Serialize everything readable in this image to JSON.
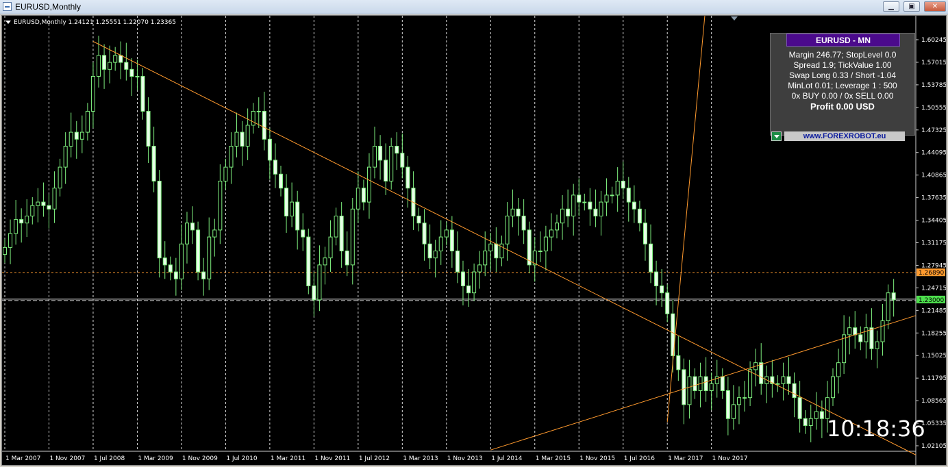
{
  "window": {
    "title": "EURUSD,Monthly",
    "minimize": "▁",
    "restore": "▣",
    "close": "✕"
  },
  "chart_header": "EURUSD,Monthly  1.24121 1.25551 1.22070 1.23365",
  "clock": "10:18:36",
  "info_panel": {
    "title": "EURUSD - MN",
    "lines": [
      "Margin 246.77; StopLevel 0.0",
      "Spread 1.9; TickValue 1.00",
      "Swap Long 0.33 / Short -1.04",
      "MinLot 0.01; Leverage 1 : 500",
      "0x BUY 0.00 / 0x SELL 0.00"
    ],
    "profit": "Profit 0.00 USD",
    "link": "www.FOREXROBOT.eu"
  },
  "colors": {
    "background": "#000000",
    "candle_up_fill": "#000000",
    "candle_up_border": "#7ff07f",
    "candle_down_fill": "#e8ffe8",
    "grid": "#ffffff",
    "trendline": "#ff9a2e",
    "current_price_badge": "#4de04d",
    "level_badge": "#ff9a2e",
    "panel_title": "#4b0a8c"
  },
  "chart_data": {
    "type": "candlestick",
    "symbol": "EURUSD",
    "timeframe": "Monthly",
    "ylim": [
      1.01,
      1.62
    ],
    "y_ticks": [
      "1.60245",
      "1.57015",
      "1.53785",
      "1.50555",
      "1.47325",
      "1.44095",
      "1.40865",
      "1.37635",
      "1.34405",
      "1.31175",
      "1.27945",
      "1.24715",
      "1.21485",
      "1.18255",
      "1.15025",
      "1.11795",
      "1.08565",
      "1.05335",
      "1.02105"
    ],
    "x_ticks": [
      "1 Mar 2007",
      "1 Nov 2007",
      "1 Jul 2008",
      "1 Mar 2009",
      "1 Nov 2009",
      "1 Jul 2010",
      "1 Mar 2011",
      "1 Nov 2011",
      "1 Jul 2012",
      "1 Mar 2013",
      "1 Nov 2013",
      "1 Jul 2014",
      "1 Mar 2015",
      "1 Nov 2015",
      "1 Jul 2016",
      "1 Mar 2017",
      "1 Nov 2017"
    ],
    "closes": [
      1.305,
      1.325,
      1.345,
      1.34,
      1.35,
      1.365,
      1.37,
      1.365,
      1.36,
      1.39,
      1.42,
      1.45,
      1.47,
      1.46,
      1.47,
      1.5,
      1.55,
      1.58,
      1.56,
      1.57,
      1.58,
      1.57,
      1.56,
      1.55,
      1.55,
      1.5,
      1.45,
      1.4,
      1.29,
      1.28,
      1.27,
      1.26,
      1.31,
      1.34,
      1.33,
      1.27,
      1.26,
      1.32,
      1.33,
      1.4,
      1.42,
      1.45,
      1.47,
      1.45,
      1.48,
      1.5,
      1.5,
      1.46,
      1.43,
      1.41,
      1.39,
      1.35,
      1.37,
      1.33,
      1.32,
      1.25,
      1.23,
      1.28,
      1.29,
      1.32,
      1.35,
      1.3,
      1.28,
      1.36,
      1.39,
      1.37,
      1.42,
      1.45,
      1.43,
      1.4,
      1.45,
      1.44,
      1.42,
      1.39,
      1.35,
      1.34,
      1.31,
      1.29,
      1.3,
      1.32,
      1.33,
      1.3,
      1.27,
      1.25,
      1.24,
      1.27,
      1.28,
      1.3,
      1.31,
      1.29,
      1.31,
      1.35,
      1.36,
      1.35,
      1.33,
      1.28,
      1.3,
      1.3,
      1.32,
      1.33,
      1.34,
      1.36,
      1.35,
      1.38,
      1.37,
      1.37,
      1.36,
      1.35,
      1.37,
      1.38,
      1.38,
      1.4,
      1.39,
      1.37,
      1.36,
      1.34,
      1.31,
      1.27,
      1.25,
      1.24,
      1.21,
      1.15,
      1.13,
      1.08,
      1.12,
      1.1,
      1.12,
      1.1,
      1.11,
      1.12,
      1.1,
      1.06,
      1.08,
      1.09,
      1.09,
      1.13,
      1.14,
      1.11,
      1.12,
      1.11,
      1.11,
      1.12,
      1.11,
      1.09,
      1.06,
      1.05,
      1.06,
      1.07,
      1.06,
      1.09,
      1.12,
      1.14,
      1.18,
      1.19,
      1.18,
      1.17,
      1.19,
      1.16,
      1.17,
      1.2,
      1.24,
      1.23
    ],
    "current_price": "1.23000",
    "level_price": "1.26890",
    "trendlines": [
      {
        "name": "descending-resistance",
        "from": [
          "1 Jul 2008",
          1.6
        ],
        "to": [
          "1 Nov 2017",
          1.155
        ]
      },
      {
        "name": "ascending-support",
        "from": [
          "1 Jul 2014",
          1.015
        ],
        "to": [
          "1 Nov 2017",
          1.115
        ]
      },
      {
        "name": "steep-support",
        "from": [
          "1 Mar 2017",
          1.055
        ],
        "to": [
          "1 Nov 2017",
          1.74
        ]
      }
    ],
    "hlines": [
      {
        "name": "level-dashed",
        "value": 1.2689
      },
      {
        "name": "current-price-line",
        "value": 1.23
      }
    ]
  }
}
